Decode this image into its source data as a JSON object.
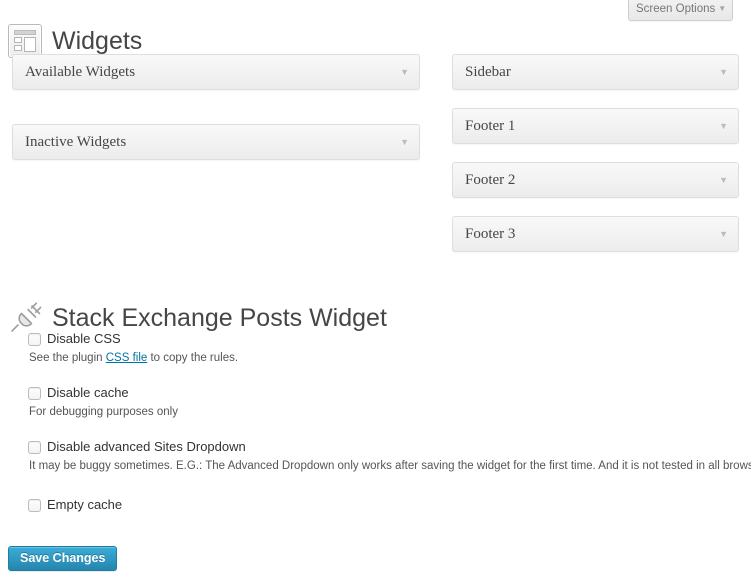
{
  "screen_options": {
    "label": "Screen Options",
    "caret_icon": "chevron-down-icon"
  },
  "header": {
    "icon": "widgets-icon",
    "title": "Widgets"
  },
  "left_column": {
    "panels": [
      {
        "title": "Available Widgets",
        "toggle_icon": "chevron-down-icon"
      },
      {
        "title": "Inactive Widgets",
        "toggle_icon": "chevron-down-icon"
      }
    ]
  },
  "right_column": {
    "panels": [
      {
        "title": "Sidebar",
        "toggle_icon": "chevron-down-icon"
      },
      {
        "title": "Footer 1",
        "toggle_icon": "chevron-down-icon"
      },
      {
        "title": "Footer 2",
        "toggle_icon": "chevron-down-icon"
      },
      {
        "title": "Footer 3",
        "toggle_icon": "chevron-down-icon"
      }
    ]
  },
  "plugin_section": {
    "icon": "plug-icon",
    "title": "Stack Exchange Posts Widget",
    "options": [
      {
        "label": "Disable CSS",
        "checked": false,
        "desc_before": "See the plugin ",
        "desc_link": "CSS file",
        "desc_after": " to copy the rules."
      },
      {
        "label": "Disable cache",
        "checked": false,
        "desc": "For debugging purposes only"
      },
      {
        "label": "Disable advanced Sites Dropdown",
        "checked": false,
        "desc": "It may be buggy sometimes. E.G.: The Advanced Dropdown only works after saving the widget for the first time. And it is not tested in all browsers."
      },
      {
        "label": "Empty cache",
        "checked": false
      }
    ]
  },
  "save_button": {
    "label": "Save Changes"
  },
  "colors": {
    "accent_blue": "#2585ae",
    "link_blue": "#0074a2",
    "text": "#333333",
    "panel_border": "#dedede"
  }
}
